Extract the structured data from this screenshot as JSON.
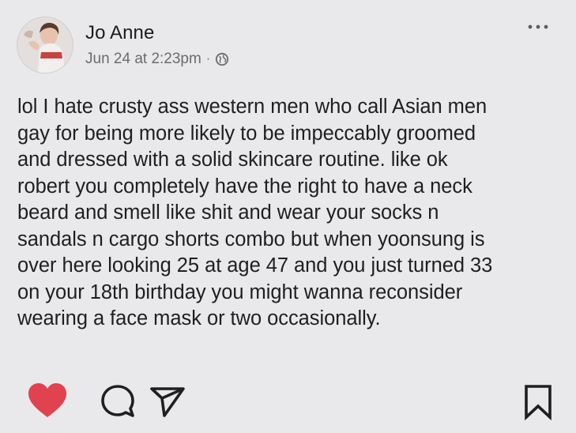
{
  "post": {
    "author_name": "Jo Anne",
    "timestamp": "Jun 24 at 2:23pm",
    "separator": "·",
    "privacy_icon": "globe-icon",
    "more_icon": "ellipsis-icon",
    "text": "lol I hate crusty ass western men who call Asian men\ngay for being more likely to be impeccably groomed\nand dressed with a solid skincare routine. like ok\nrobert you completely have the right to have a neck\nbeard and smell like shit and wear your socks n\nsandals n cargo shorts combo but when yoonsung is\nover here looking 25 at age 47 and you just turned 33\non your 18th birthday you might wanna reconsider\nwearing a face mask or two occasionally."
  },
  "actions": {
    "like_icon": "heart-icon",
    "comment_icon": "comment-icon",
    "share_icon": "send-icon",
    "save_icon": "bookmark-icon",
    "liked": true
  },
  "colors": {
    "background": "#e9e8ea",
    "text": "#1f1f22",
    "meta": "#6c6b70",
    "like": "#e0434f"
  }
}
